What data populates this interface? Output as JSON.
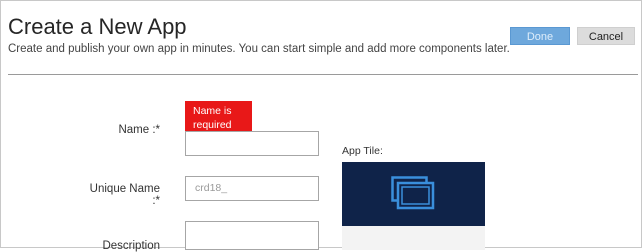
{
  "header": {
    "title": "Create a New App",
    "subtitle": "Create and publish your own app in minutes. You can start simple and add more components later."
  },
  "actions": {
    "done_label": "Done",
    "cancel_label": "Cancel"
  },
  "form": {
    "name_label": "Name :*",
    "name_error": "Name is required",
    "name_value": "",
    "unique_name_label": "Unique Name :*",
    "unique_name_value": "crd18_",
    "description_label": "Description"
  },
  "tile": {
    "label": "App Tile:",
    "icon": "app-tile-icon",
    "color": "#0f2349"
  },
  "colors": {
    "done_button": "#6ea8dc",
    "error": "#e81818"
  }
}
